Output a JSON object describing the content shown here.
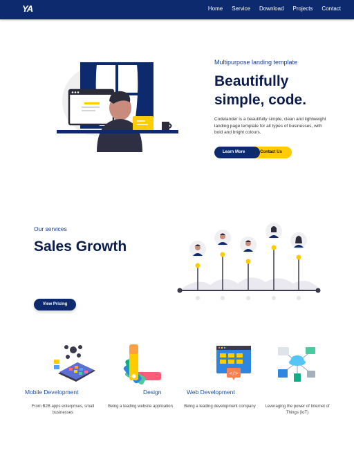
{
  "nav": {
    "logo": "YA",
    "links": [
      "Home",
      "Service",
      "Download",
      "Projects",
      "Contact"
    ]
  },
  "hero": {
    "eyebrow": "Multipurpose landing template",
    "title_line1": "Beautifully",
    "title_line2": "simple, code.",
    "description": "Codelander is a beautifully simple, clean and lightweight landing page template for all types of businesses, with bold and bright colours.",
    "learn_more": "Learn More",
    "contact_us": "Contact Us"
  },
  "services": {
    "eyebrow": "Our services",
    "title": "Sales Growth",
    "pricing_button": "View Pricing"
  },
  "features": [
    {
      "title": "Mobile Development",
      "desc": "From B2B apps  enterprises, small businesses",
      "icon": "mobile-apps-icon"
    },
    {
      "title": "Design",
      "desc": "Being a leading website application",
      "icon": "color-palette-icon"
    },
    {
      "title": "Web Development",
      "desc": "Being a leading development company",
      "icon": "web-code-icon"
    },
    {
      "title": "",
      "desc": "Leveraging the power of Internet of Things (IoT)",
      "icon": "iot-network-icon"
    }
  ],
  "colors": {
    "navy": "#0d2a6e",
    "accent_yellow": "#ffcc00",
    "link_blue": "#1f4fa8"
  }
}
